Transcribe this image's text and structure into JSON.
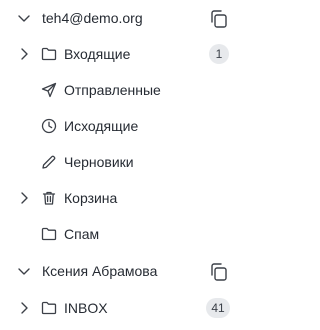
{
  "accounts": [
    {
      "email": "teh4@demo.org",
      "copy_icon": "copy-icon",
      "folders": [
        {
          "label": "Входящие",
          "icon": "folder-icon",
          "expandable": true,
          "badge": "1"
        },
        {
          "label": "Отправленные",
          "icon": "send-icon",
          "expandable": false
        },
        {
          "label": "Исходящие",
          "icon": "clock-icon",
          "expandable": false
        },
        {
          "label": "Черновики",
          "icon": "pencil-icon",
          "expandable": false
        },
        {
          "label": "Корзина",
          "icon": "trash-icon",
          "expandable": true
        },
        {
          "label": "Спам",
          "icon": "folder-icon",
          "expandable": false
        }
      ]
    },
    {
      "name": "Ксения Абрамова",
      "copy_icon": "copy-icon",
      "folders": [
        {
          "label": "INBOX",
          "icon": "folder-icon",
          "expandable": true,
          "badge": "41"
        }
      ]
    }
  ],
  "colors": {
    "text": "#262b33",
    "icon": "#3c4048",
    "badge_bg": "#e7e9ec"
  }
}
